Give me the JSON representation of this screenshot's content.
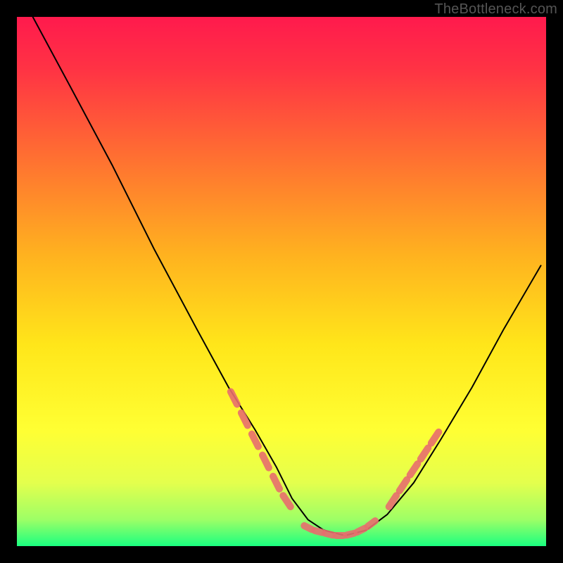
{
  "watermark": "TheBottleneck.com",
  "gradient": {
    "stops": [
      {
        "offset": 0.0,
        "color": "#ff1a4d"
      },
      {
        "offset": 0.1,
        "color": "#ff3344"
      },
      {
        "offset": 0.25,
        "color": "#ff6a33"
      },
      {
        "offset": 0.45,
        "color": "#ffb21f"
      },
      {
        "offset": 0.62,
        "color": "#ffe61a"
      },
      {
        "offset": 0.78,
        "color": "#ffff33"
      },
      {
        "offset": 0.88,
        "color": "#e4ff4d"
      },
      {
        "offset": 0.95,
        "color": "#9dff66"
      },
      {
        "offset": 1.0,
        "color": "#1aff80"
      }
    ]
  },
  "chart_data": {
    "type": "line",
    "title": "",
    "xlabel": "",
    "ylabel": "",
    "xlim": [
      0,
      100
    ],
    "ylim": [
      0,
      100
    ],
    "note": "Axes normalized 0-100 (horizontal left→right, vertical bottom→top)",
    "series": [
      {
        "name": "curve",
        "color": "#000000",
        "x": [
          3,
          10,
          18,
          26,
          34,
          40,
          45,
          49,
          52,
          55,
          58,
          62,
          66,
          70,
          75,
          80,
          86,
          92,
          99
        ],
        "y": [
          100,
          87,
          72,
          56,
          41,
          30,
          22,
          15,
          9,
          5,
          3,
          2,
          3,
          6,
          12,
          20,
          30,
          41,
          53
        ]
      },
      {
        "name": "highlight-left-dashes",
        "color": "#e86e6e",
        "style": "dashed",
        "x": [
          40,
          42,
          44,
          46,
          48,
          50,
          52
        ],
        "y": [
          30,
          26,
          22,
          18,
          14,
          10,
          7
        ]
      },
      {
        "name": "highlight-bottom-dashes",
        "color": "#e86e6e",
        "style": "dashed",
        "x": [
          54,
          56,
          58,
          60,
          62,
          64,
          66,
          68
        ],
        "y": [
          4,
          3,
          2.5,
          2,
          2,
          2.5,
          3.5,
          5
        ]
      },
      {
        "name": "highlight-right-dashes",
        "color": "#e86e6e",
        "style": "dashed",
        "x": [
          70,
          72,
          74,
          76,
          78,
          80
        ],
        "y": [
          7,
          10,
          13,
          16,
          19,
          22
        ]
      }
    ]
  }
}
